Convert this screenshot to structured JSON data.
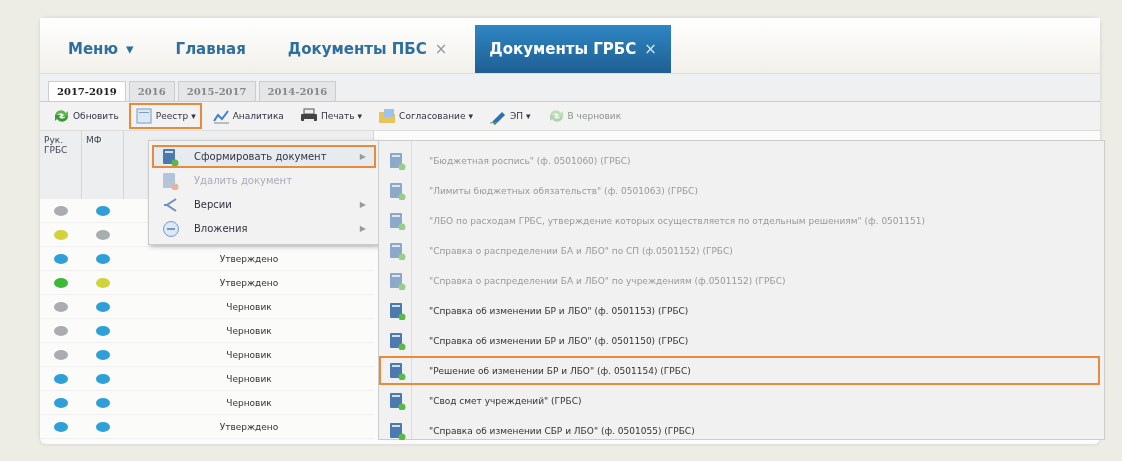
{
  "nav_tabs": [
    {
      "label": "Меню",
      "arrow": "▾",
      "selected": false
    },
    {
      "label": "Главная",
      "selected": false
    },
    {
      "label": "Документы ПБС",
      "close": "×",
      "selected": false
    },
    {
      "label": "Документы ГРБС",
      "close": "×",
      "selected": true
    }
  ],
  "year_tabs": [
    {
      "label": "2017-2019",
      "selected": true
    },
    {
      "label": "2016",
      "selected": false
    },
    {
      "label": "2015-2017",
      "selected": false
    },
    {
      "label": "2014-2016",
      "selected": false
    }
  ],
  "toolbar": [
    {
      "kind": "refresh",
      "label": "Обновить",
      "disabled": false,
      "highlighted": false
    },
    {
      "kind": "register",
      "label": "Реестр",
      "arrow": "▾",
      "disabled": false,
      "highlighted": true
    },
    {
      "kind": "analytics",
      "label": "Аналитика",
      "disabled": false,
      "highlighted": false
    },
    {
      "kind": "print",
      "label": "Печать",
      "arrow": "▾",
      "disabled": false,
      "highlighted": false
    },
    {
      "kind": "approval",
      "label": "Согласование",
      "arrow": "▾",
      "disabled": false,
      "highlighted": false
    },
    {
      "kind": "signature",
      "label": "ЭП",
      "arrow": "▾",
      "disabled": false,
      "highlighted": false
    },
    {
      "kind": "refresh",
      "label": "В черновик",
      "disabled": true,
      "highlighted": false
    }
  ],
  "grid": {
    "columns": [
      "Рук. ГРБС",
      "МФ"
    ],
    "rows": [
      {
        "dots": [
          {
            "color": "#a9adb2"
          },
          {
            "color": "#2f9fd8"
          }
        ]
      },
      {
        "dots": [
          {
            "color": "#d2d23c"
          },
          {
            "color": "#a9adb2"
          }
        ]
      },
      {
        "dots": [
          {
            "color": "#2f9fd8"
          },
          {
            "color": "#2f9fd8"
          }
        ],
        "status": "Утверждено"
      },
      {
        "dots": [
          {
            "color": "#3fb83a"
          },
          {
            "color": "#d2d23c"
          }
        ],
        "status": "Утверждено"
      },
      {
        "dots": [
          {
            "color": "#a9adb2"
          },
          {
            "color": "#2f9fd8"
          }
        ],
        "status": "Черновик"
      },
      {
        "dots": [
          {
            "color": "#a9adb2"
          },
          {
            "color": "#2f9fd8"
          }
        ],
        "status": "Черновик"
      },
      {
        "dots": [
          {
            "color": "#a9adb2"
          },
          {
            "color": "#2f9fd8"
          }
        ],
        "status": "Черновик"
      },
      {
        "dots": [
          {
            "color": "#2f9fd8"
          },
          {
            "color": "#2f9fd8"
          }
        ],
        "status": "Черновик"
      },
      {
        "dots": [
          {
            "color": "#2f9fd8"
          },
          {
            "color": "#2f9fd8"
          }
        ],
        "status": "Черновик"
      },
      {
        "dots": [
          {
            "color": "#2f9fd8"
          },
          {
            "color": "#2f9fd8"
          }
        ],
        "status": "Утверждено"
      }
    ]
  },
  "menu": [
    {
      "kind": "document",
      "label": "Сформировать документ",
      "arrow": "▶",
      "disabled": false,
      "selected": true
    },
    {
      "kind": "delete",
      "label": "Удалить документ",
      "disabled": true,
      "selected": false
    },
    {
      "kind": "versions",
      "label": "Версии",
      "arrow": "▶",
      "disabled": false,
      "selected": false
    },
    {
      "kind": "attachments",
      "label": "Вложения",
      "arrow": "▶",
      "disabled": false,
      "selected": false
    }
  ],
  "submenu": [
    {
      "label": "\"Бюджетная роспись\" (ф. 0501060) (ГРБС)",
      "disabled": true,
      "selected": false
    },
    {
      "label": "\"Лимиты бюджетных обязательств\" (ф. 0501063) (ГРБС)",
      "disabled": true,
      "selected": false
    },
    {
      "label": "\"ЛБО по расходам ГРБС, утверждение которых осуществляется по отдельным решениям\" (ф. 0501151)",
      "disabled": true,
      "selected": false
    },
    {
      "label": "\"Справка о распределении БА и ЛБО\" по СП (ф.0501152) (ГРБС)",
      "disabled": true,
      "selected": false
    },
    {
      "label": "\"Справка о распределении БА и ЛБО\" по учреждениям (ф.0501152) (ГРБС)",
      "disabled": true,
      "selected": false
    },
    {
      "label": "\"Справка об изменении БР и ЛБО\" (ф. 0501153) (ГРБС)",
      "disabled": false,
      "selected": false
    },
    {
      "label": "\"Справка об изменении БР и ЛБО\" (ф. 0501150) (ГРБС)",
      "disabled": false,
      "selected": false
    },
    {
      "label": "\"Решение об изменении БР и ЛБО\" (ф. 0501154) (ГРБС)",
      "disabled": false,
      "selected": true
    },
    {
      "label": "\"Свод смет учреждений\" (ГРБС)",
      "disabled": false,
      "selected": false
    },
    {
      "label": "\"Справка об изменении СБР и ЛБО\" (ф. 0501055) (ГРБС)",
      "disabled": false,
      "selected": false
    }
  ]
}
